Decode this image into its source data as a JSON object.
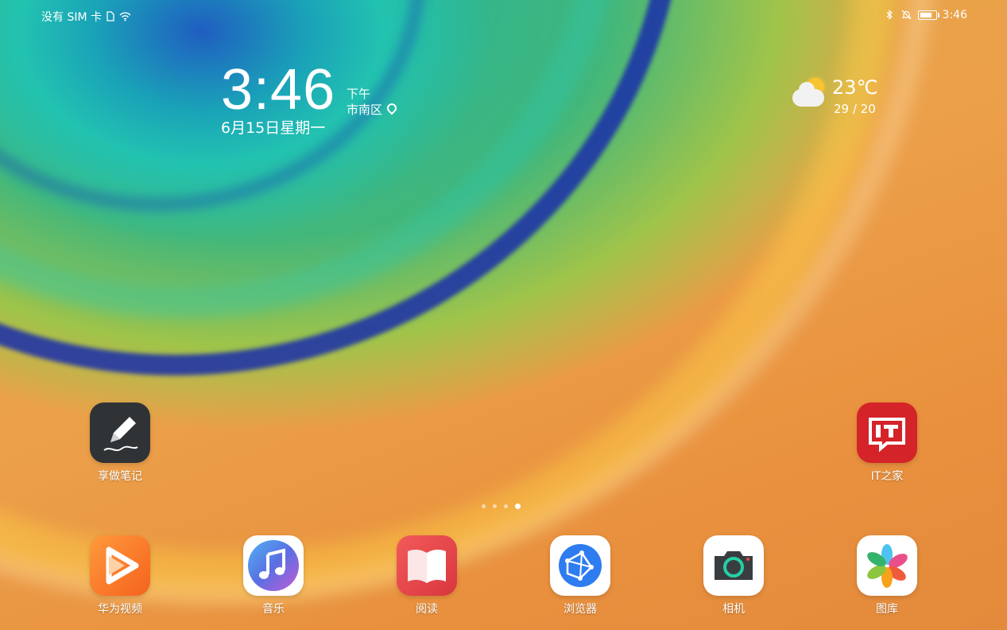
{
  "status_bar": {
    "carrier": "没有 SIM 卡",
    "time": "3:46",
    "icons": [
      "sim-icon",
      "wifi-icon",
      "bluetooth-icon",
      "mute-bell-icon",
      "battery-icon"
    ]
  },
  "clock_widget": {
    "time": "3:46",
    "period": "下午",
    "location": "市南区",
    "date": "6月15日星期一"
  },
  "weather": {
    "temperature": "23℃",
    "range": "29 / 20",
    "icon": "partly-cloudy-icon"
  },
  "home_apps": [
    {
      "label": "享做笔记",
      "icon": "pen-icon"
    },
    {
      "label": "IT之家",
      "icon": "ithome-icon"
    }
  ],
  "page_indicator": {
    "pages": 4,
    "active": 4
  },
  "dock": [
    {
      "label": "华为视频",
      "icon": "video-play-icon"
    },
    {
      "label": "音乐",
      "icon": "music-note-icon"
    },
    {
      "label": "阅读",
      "icon": "book-icon"
    },
    {
      "label": "浏览器",
      "icon": "browser-globe-icon"
    },
    {
      "label": "相机",
      "icon": "camera-icon"
    },
    {
      "label": "图库",
      "icon": "gallery-pinwheel-icon"
    }
  ],
  "colors": {
    "video_app": "#f77d27",
    "music_app": "#5a6fe3",
    "reading_app": "#e94a4a",
    "browser_app": "#2e7cf0",
    "camera_accent": "#25d0a6",
    "ithome_app": "#d42329",
    "notes_app": "#2f3336"
  }
}
